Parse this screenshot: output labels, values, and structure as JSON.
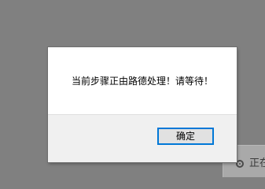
{
  "background": {
    "partial_label": "正在"
  },
  "dialog": {
    "message": "当前步骤正由路德处理！请等待！",
    "ok_label": "确定"
  },
  "colors": {
    "overlay": "#808080",
    "dialog_body": "#ffffff",
    "dialog_footer": "#f0f0f0",
    "button_border": "#0078d7",
    "button_fill": "#e1e1e1"
  }
}
